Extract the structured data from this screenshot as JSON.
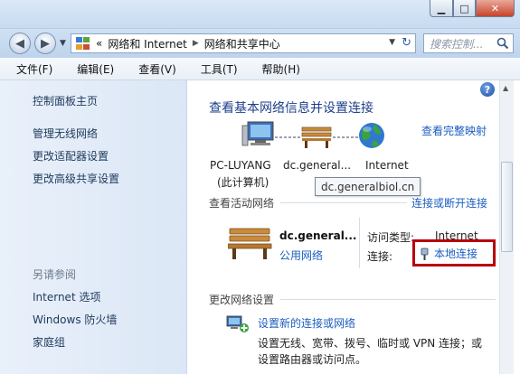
{
  "window": {
    "min_icon": "minimize-icon",
    "max_icon": "maximize-icon",
    "close_icon": "close-icon"
  },
  "nav": {
    "back_icon": "back-arrow-icon",
    "forward_icon": "forward-arrow-icon",
    "breadcrumb": {
      "prefix": "«",
      "items": [
        "网络和 Internet",
        "网络和共享中心"
      ]
    },
    "search_placeholder": "搜索控制..."
  },
  "menu": [
    "文件(F)",
    "编辑(E)",
    "查看(V)",
    "工具(T)",
    "帮助(H)"
  ],
  "sidebar": {
    "home": "控制面板主页",
    "links": [
      "管理无线网络",
      "更改适配器设置",
      "更改高级共享设置"
    ],
    "see_also_title": "另请参阅",
    "see_also": [
      "Internet 选项",
      "Windows 防火墙",
      "家庭组"
    ]
  },
  "main": {
    "title": "查看基本网络信息并设置连接",
    "full_map": "查看完整映射",
    "nodes": [
      {
        "label_1": "PC-LUYANG",
        "label_2": "(此计算机)"
      },
      {
        "label_1": "dc.general..."
      },
      {
        "label_1": "Internet"
      }
    ],
    "tooltip": "dc.generalbiol.cn",
    "active_networks_label": "查看活动网络",
    "connect_disconnect": "连接或断开连接",
    "network": {
      "name": "dc.general...",
      "type": "公用网络",
      "access_type_label": "访问类型:",
      "access_type_value": "Internet",
      "connection_label": "连接:",
      "connection_value": "本地连接"
    },
    "change_settings_label": "更改网络设置",
    "setup_link": "设置新的连接或网络",
    "setup_desc_1": "设置无线、宽带、拨号、临时或 VPN 连接；或",
    "setup_desc_2": "设置路由器或访问点。"
  },
  "colors": {
    "highlight": "#b8000c",
    "link": "#1c5ec0",
    "title": "#1e3f8a"
  }
}
